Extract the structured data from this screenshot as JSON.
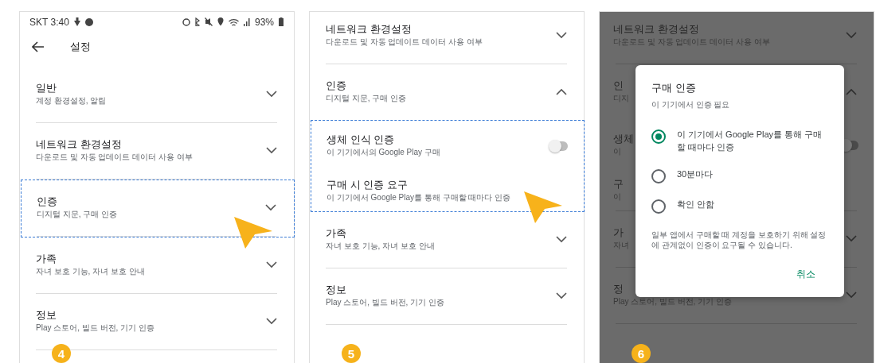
{
  "panels": [
    {
      "dimmed": false,
      "status_bar": {
        "carrier_time": "SKT 3:40",
        "battery": "93%"
      },
      "header": {
        "title": "설정"
      },
      "items": [
        {
          "kind": "section",
          "title": "일반",
          "subtitle": "계정 환경설정, 알림",
          "expanded": false,
          "highlighted": false
        },
        {
          "kind": "section",
          "title": "네트워크 환경설정",
          "subtitle": "다운로드 및 자동 업데이트 데이터 사용 여부",
          "expanded": false,
          "highlighted": false
        },
        {
          "kind": "section",
          "title": "인증",
          "subtitle": "디지털 지문, 구매 인증",
          "expanded": false,
          "highlighted": true
        },
        {
          "kind": "section",
          "title": "가족",
          "subtitle": "자녀 보호 기능, 자녀 보호 안내",
          "expanded": false,
          "highlighted": false
        },
        {
          "kind": "section",
          "title": "정보",
          "subtitle": "Play 스토어, 빌드 버전, 기기 인증",
          "expanded": false,
          "highlighted": false
        }
      ],
      "step": "4"
    },
    {
      "dimmed": false,
      "items": [
        {
          "kind": "section",
          "title": "네트워크 환경설정",
          "subtitle": "다운로드 및 자동 업데이트 데이터 사용 여부",
          "expanded": false,
          "highlighted": false
        },
        {
          "kind": "section",
          "title": "인증",
          "subtitle": "디지털 지문, 구매 인증",
          "expanded": true,
          "highlighted": false
        },
        {
          "kind": "toggle",
          "title": "생체 인식 인증",
          "subtitle": "이 기기에서의 Google Play 구매",
          "on": false,
          "highlighted": true
        },
        {
          "kind": "sub",
          "title": "구매 시 인증 요구",
          "subtitle": "이 기기에서 Google Play를 통해 구매할 때마다 인증",
          "highlighted": true
        },
        {
          "kind": "section",
          "title": "가족",
          "subtitle": "자녀 보호 기능, 자녀 보호 안내",
          "expanded": false,
          "highlighted": false
        },
        {
          "kind": "section",
          "title": "정보",
          "subtitle": "Play 스토어, 빌드 버전, 기기 인증",
          "expanded": false,
          "highlighted": false
        }
      ],
      "step": "5"
    },
    {
      "dimmed": true,
      "items": [
        {
          "kind": "section",
          "title": "네트워크 환경설정",
          "subtitle": "다운로드 및 자동 업데이트 데이터 사용 여부",
          "expanded": false,
          "highlighted": false
        },
        {
          "kind": "section",
          "title": "인",
          "subtitle": "디지",
          "expanded": true,
          "highlighted": false
        },
        {
          "kind": "toggle",
          "title": "생체",
          "subtitle": "이",
          "on": false,
          "highlighted": false
        },
        {
          "kind": "sub",
          "title": "구",
          "subtitle": "이",
          "highlighted": false
        },
        {
          "kind": "section",
          "title": "가",
          "subtitle": "자녀",
          "expanded": false,
          "highlighted": false
        },
        {
          "kind": "section",
          "title": "정",
          "subtitle": "Play 스토어, 빌드 버전, 기기 인증",
          "expanded": false,
          "highlighted": false
        }
      ],
      "dialog": {
        "title": "구매 인증",
        "subtitle": "이 기기에서 인증 필요",
        "options": [
          {
            "label": "이 기기에서 Google Play를 통해 구매할 때마다 인증",
            "selected": true
          },
          {
            "label": "30분마다",
            "selected": false
          },
          {
            "label": "확인 안함",
            "selected": false
          }
        ],
        "note": "일부 앱에서 구매할 때 계정을 보호하기 위해 설정에 관계없이 인증이 요구될 수 있습니다.",
        "button": "취소"
      },
      "step": "6"
    }
  ]
}
